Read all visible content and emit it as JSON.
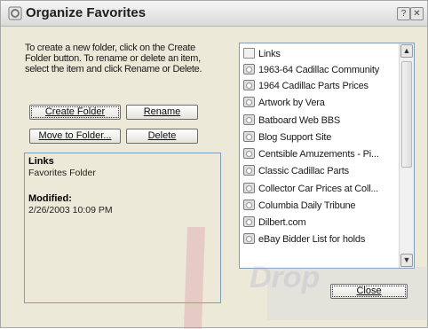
{
  "window": {
    "title": "Organize Favorites",
    "help_label": "?",
    "close_label": "✕"
  },
  "description": "To create a new folder, click on the Create Folder button. To rename or delete an item, select the item and click Rename or Delete.",
  "buttons": {
    "create_folder": "Create Folder",
    "rename": "Rename",
    "move_to_folder": "Move to Folder...",
    "delete": "Delete",
    "close": "Close"
  },
  "info": {
    "name": "Links",
    "type": "Favorites Folder",
    "modified_label": "Modified:",
    "modified_value": "2/26/2003 10:09 PM"
  },
  "favorites": {
    "items": [
      {
        "label": "Links",
        "icon": "folder-icon"
      },
      {
        "label": "1963-64 Cadillac Community",
        "icon": "ie-page-icon"
      },
      {
        "label": "1964 Cadillac Parts Prices",
        "icon": "ie-page-icon"
      },
      {
        "label": "Artwork by Vera",
        "icon": "ie-page-icon"
      },
      {
        "label": "Batboard Web BBS",
        "icon": "ie-page-icon"
      },
      {
        "label": "Blog Support Site",
        "icon": "ie-page-icon"
      },
      {
        "label": "Centsible Amuzements - Pi...",
        "icon": "ie-page-icon"
      },
      {
        "label": "Classic Cadillac Parts",
        "icon": "ie-page-icon"
      },
      {
        "label": "Collector Car Prices at Coll...",
        "icon": "ie-page-icon"
      },
      {
        "label": "Columbia Daily Tribune",
        "icon": "ie-page-icon"
      },
      {
        "label": "Dilbert.com",
        "icon": "ie-page-icon"
      },
      {
        "label": "eBay Bidder List for holds",
        "icon": "ie-page-icon"
      }
    ],
    "scroll_up": "▲",
    "scroll_down": "▼"
  },
  "watermark": "Drop"
}
